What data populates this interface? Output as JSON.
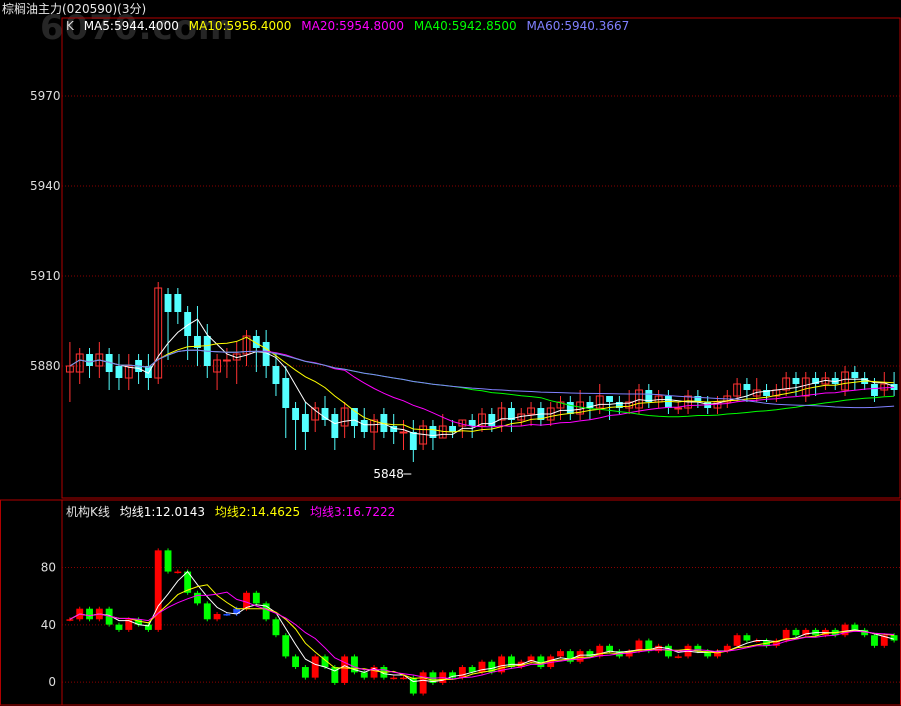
{
  "header": {
    "title": "棕榈油主力(020590)(3分)",
    "watermark": "6070.com"
  },
  "main_legend": {
    "k_label": "K",
    "items": [
      {
        "text": "MA5:5944.4000",
        "color": "#ffffff"
      },
      {
        "text": "MA10:5956.4000",
        "color": "#ffff00"
      },
      {
        "text": "MA20:5954.8000",
        "color": "#ff00ff"
      },
      {
        "text": "MA40:5942.8500",
        "color": "#00ff00"
      },
      {
        "text": "MA60:5940.3667",
        "color": "#8080ff"
      }
    ]
  },
  "sub_legend": {
    "name": "机构K线",
    "items": [
      {
        "text": "均线1:12.0143",
        "color": "#ffffff"
      },
      {
        "text": "均线2:14.4625",
        "color": "#ffff00"
      },
      {
        "text": "均线3:16.7222",
        "color": "#ff00ff"
      }
    ]
  },
  "colors": {
    "up": "#ff3232",
    "down": "#54ffff",
    "grid": "#8b0000",
    "border": "#b00000",
    "axis_text": "#dddddd",
    "sub_up": "#ff0000",
    "sub_down": "#00ff00",
    "sub_blue": "#2050ff",
    "sub_orange": "#ffa040"
  },
  "chart_data": [
    {
      "type": "candlestick",
      "ylim": [
        5836,
        5996
      ],
      "y_ticks": [
        5880,
        5910,
        5940,
        5970
      ],
      "low_annotation": "5848",
      "candles": [
        [
          5878,
          5880,
          5868,
          5888
        ],
        [
          5878,
          5884,
          5874,
          5886
        ],
        [
          5884,
          5880,
          5876,
          5886
        ],
        [
          5880,
          5884,
          5876,
          5888
        ],
        [
          5884,
          5878,
          5872,
          5886
        ],
        [
          5880,
          5876,
          5872,
          5884
        ],
        [
          5876,
          5880,
          5872,
          5884
        ],
        [
          5882,
          5878,
          5874,
          5884
        ],
        [
          5880,
          5876,
          5872,
          5884
        ],
        [
          5876,
          5906,
          5874,
          5908
        ],
        [
          5904,
          5898,
          5882,
          5906
        ],
        [
          5904,
          5898,
          5894,
          5906
        ],
        [
          5898,
          5890,
          5882,
          5900
        ],
        [
          5890,
          5886,
          5880,
          5900
        ],
        [
          5890,
          5880,
          5876,
          5894
        ],
        [
          5878,
          5882,
          5872,
          5884
        ],
        [
          5882,
          5882,
          5876,
          5886
        ],
        [
          5882,
          5884,
          5874,
          5888
        ],
        [
          5884,
          5890,
          5880,
          5892
        ],
        [
          5890,
          5886,
          5878,
          5892
        ],
        [
          5888,
          5880,
          5876,
          5892
        ],
        [
          5880,
          5874,
          5870,
          5884
        ],
        [
          5876,
          5866,
          5856,
          5880
        ],
        [
          5866,
          5862,
          5852,
          5868
        ],
        [
          5864,
          5858,
          5852,
          5868
        ],
        [
          5862,
          5866,
          5858,
          5868
        ],
        [
          5866,
          5862,
          5860,
          5870
        ],
        [
          5864,
          5856,
          5852,
          5866
        ],
        [
          5860,
          5866,
          5856,
          5868
        ],
        [
          5866,
          5860,
          5856,
          5866
        ],
        [
          5862,
          5858,
          5856,
          5866
        ],
        [
          5858,
          5862,
          5852,
          5864
        ],
        [
          5864,
          5858,
          5856,
          5866
        ],
        [
          5860,
          5858,
          5854,
          5864
        ],
        [
          5858,
          5858,
          5852,
          5862
        ],
        [
          5858,
          5852,
          5848,
          5862
        ],
        [
          5854,
          5860,
          5852,
          5862
        ],
        [
          5860,
          5856,
          5852,
          5862
        ],
        [
          5856,
          5860,
          5856,
          5864
        ],
        [
          5860,
          5858,
          5856,
          5862
        ],
        [
          5860,
          5862,
          5856,
          5862
        ],
        [
          5862,
          5860,
          5856,
          5864
        ],
        [
          5860,
          5864,
          5858,
          5866
        ],
        [
          5864,
          5860,
          5858,
          5866
        ],
        [
          5862,
          5866,
          5858,
          5868
        ],
        [
          5866,
          5862,
          5858,
          5868
        ],
        [
          5862,
          5864,
          5860,
          5866
        ],
        [
          5864,
          5866,
          5860,
          5868
        ],
        [
          5866,
          5862,
          5860,
          5868
        ],
        [
          5862,
          5866,
          5860,
          5868
        ],
        [
          5866,
          5868,
          5862,
          5870
        ],
        [
          5868,
          5864,
          5862,
          5870
        ],
        [
          5864,
          5868,
          5862,
          5872
        ],
        [
          5868,
          5866,
          5862,
          5870
        ],
        [
          5866,
          5870,
          5864,
          5874
        ],
        [
          5870,
          5868,
          5862,
          5870
        ],
        [
          5868,
          5866,
          5864,
          5870
        ],
        [
          5866,
          5868,
          5864,
          5872
        ],
        [
          5866,
          5872,
          5864,
          5874
        ],
        [
          5872,
          5868,
          5866,
          5874
        ],
        [
          5868,
          5870,
          5866,
          5872
        ],
        [
          5870,
          5866,
          5864,
          5872
        ],
        [
          5866,
          5866,
          5864,
          5868
        ],
        [
          5866,
          5870,
          5864,
          5872
        ],
        [
          5870,
          5868,
          5866,
          5872
        ],
        [
          5868,
          5866,
          5864,
          5870
        ],
        [
          5866,
          5868,
          5864,
          5870
        ],
        [
          5868,
          5870,
          5866,
          5872
        ],
        [
          5870,
          5874,
          5868,
          5876
        ],
        [
          5874,
          5872,
          5868,
          5876
        ],
        [
          5870,
          5872,
          5868,
          5876
        ],
        [
          5872,
          5870,
          5868,
          5874
        ],
        [
          5870,
          5872,
          5868,
          5874
        ],
        [
          5872,
          5876,
          5870,
          5878
        ],
        [
          5876,
          5874,
          5870,
          5878
        ],
        [
          5870,
          5876,
          5868,
          5878
        ],
        [
          5876,
          5874,
          5870,
          5878
        ],
        [
          5874,
          5876,
          5872,
          5878
        ],
        [
          5876,
          5874,
          5872,
          5878
        ],
        [
          5872,
          5878,
          5870,
          5880
        ],
        [
          5878,
          5876,
          5872,
          5880
        ],
        [
          5876,
          5874,
          5872,
          5878
        ],
        [
          5874,
          5870,
          5868,
          5876
        ],
        [
          5872,
          5874,
          5870,
          5878
        ],
        [
          5874,
          5872,
          5870,
          5878
        ]
      ]
    },
    {
      "type": "candlestick",
      "ylim": [
        -16,
        116
      ],
      "y_ticks": [
        0,
        40,
        80
      ]
    }
  ]
}
